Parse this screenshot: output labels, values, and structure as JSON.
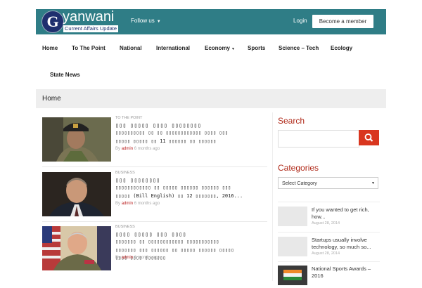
{
  "brand": {
    "logo_letter": "G",
    "name": "yanwani",
    "tagline": "Current Affairs Update",
    "colors": {
      "topbar": "#2f7d86",
      "accent": "#b02a1a",
      "search_button": "#d9361f"
    }
  },
  "topbar": {
    "follow_label": "Follow us",
    "login_label": "Login",
    "member_label": "Become a member"
  },
  "nav": {
    "items": [
      {
        "label": "Home"
      },
      {
        "label": "To The Point"
      },
      {
        "label": "National"
      },
      {
        "label": "International"
      },
      {
        "label": "Economy"
      },
      {
        "label": "Sports"
      },
      {
        "label": "Science – Tech"
      },
      {
        "label": "Ecology"
      },
      {
        "label": "State News"
      }
    ]
  },
  "breadcrumb": {
    "label": "Home"
  },
  "posts": [
    {
      "category": "TO THE POINT",
      "title": "▯▯▯ ▯▯▯▯▯ ▯▯▯▯ ▯▯▯▯▯▯▯▯",
      "excerpt": "▯▯▯▯▯▯▯▯▯▯ ▯▯ ▯▯ ▯▯▯▯▯▯▯▯▯▯▯▯ ▯▯▯▯ ▯▯▯\n▯▯▯▯▯ ▯▯▯▯▯ ▯▯ 11 ▯▯▯▯▯▯ ▯▯ ▯▯▯▯▯▯",
      "by_label": "By",
      "author": "admin",
      "time": "6 months ago"
    },
    {
      "category": "BUSINESS",
      "title": "▯▯▯ ▯▯▯▯▯▯▯▯",
      "excerpt": "▯▯▯▯▯▯▯▯▯▯▯▯ ▯▯ ▯▯▯▯▯ ▯▯▯▯▯▯ ▯▯▯▯▯▯ ▯▯▯\n▯▯▯▯▯ (Bill English) ▯▯ 12 ▯▯▯▯▯▯▯, 2016...",
      "by_label": "By",
      "author": "admin",
      "time": "6 months ago"
    },
    {
      "category": "BUSINESS",
      "title": "▯▯▯▯ ▯▯▯▯▯ ▯▯▯ ▯▯▯▯",
      "excerpt": "▯▯▯▯▯▯▯ ▯▯ ▯▯▯▯▯▯▯▯▯▯▯▯ ▯▯▯▯▯▯▯▯▯▯▯\n▯▯▯▯▯▯▯ ▯▯▯ ▯▯▯▯▯▯ ▯▯ ▯▯▯▯▯ ▯▯▯▯▯▯ ▯▯▯▯▯\n▯▯▯▯ ▯▯▯▯ ▯▯▯▯▯▯▯",
      "by_label": "By",
      "author": "admin",
      "time": "6 months ago"
    }
  ],
  "sidebar": {
    "search_heading": "Search",
    "search_placeholder": "",
    "categories_heading": "Categories",
    "category_select": "Select Category",
    "recent": [
      {
        "title": "If you wanted to get rich, how...",
        "date": "August 28, 2014"
      },
      {
        "title": "Startups usually involve technology, so much so...",
        "date": "August 28, 2014"
      },
      {
        "title": "National Sports Awards – 2016",
        "date": ""
      }
    ]
  }
}
